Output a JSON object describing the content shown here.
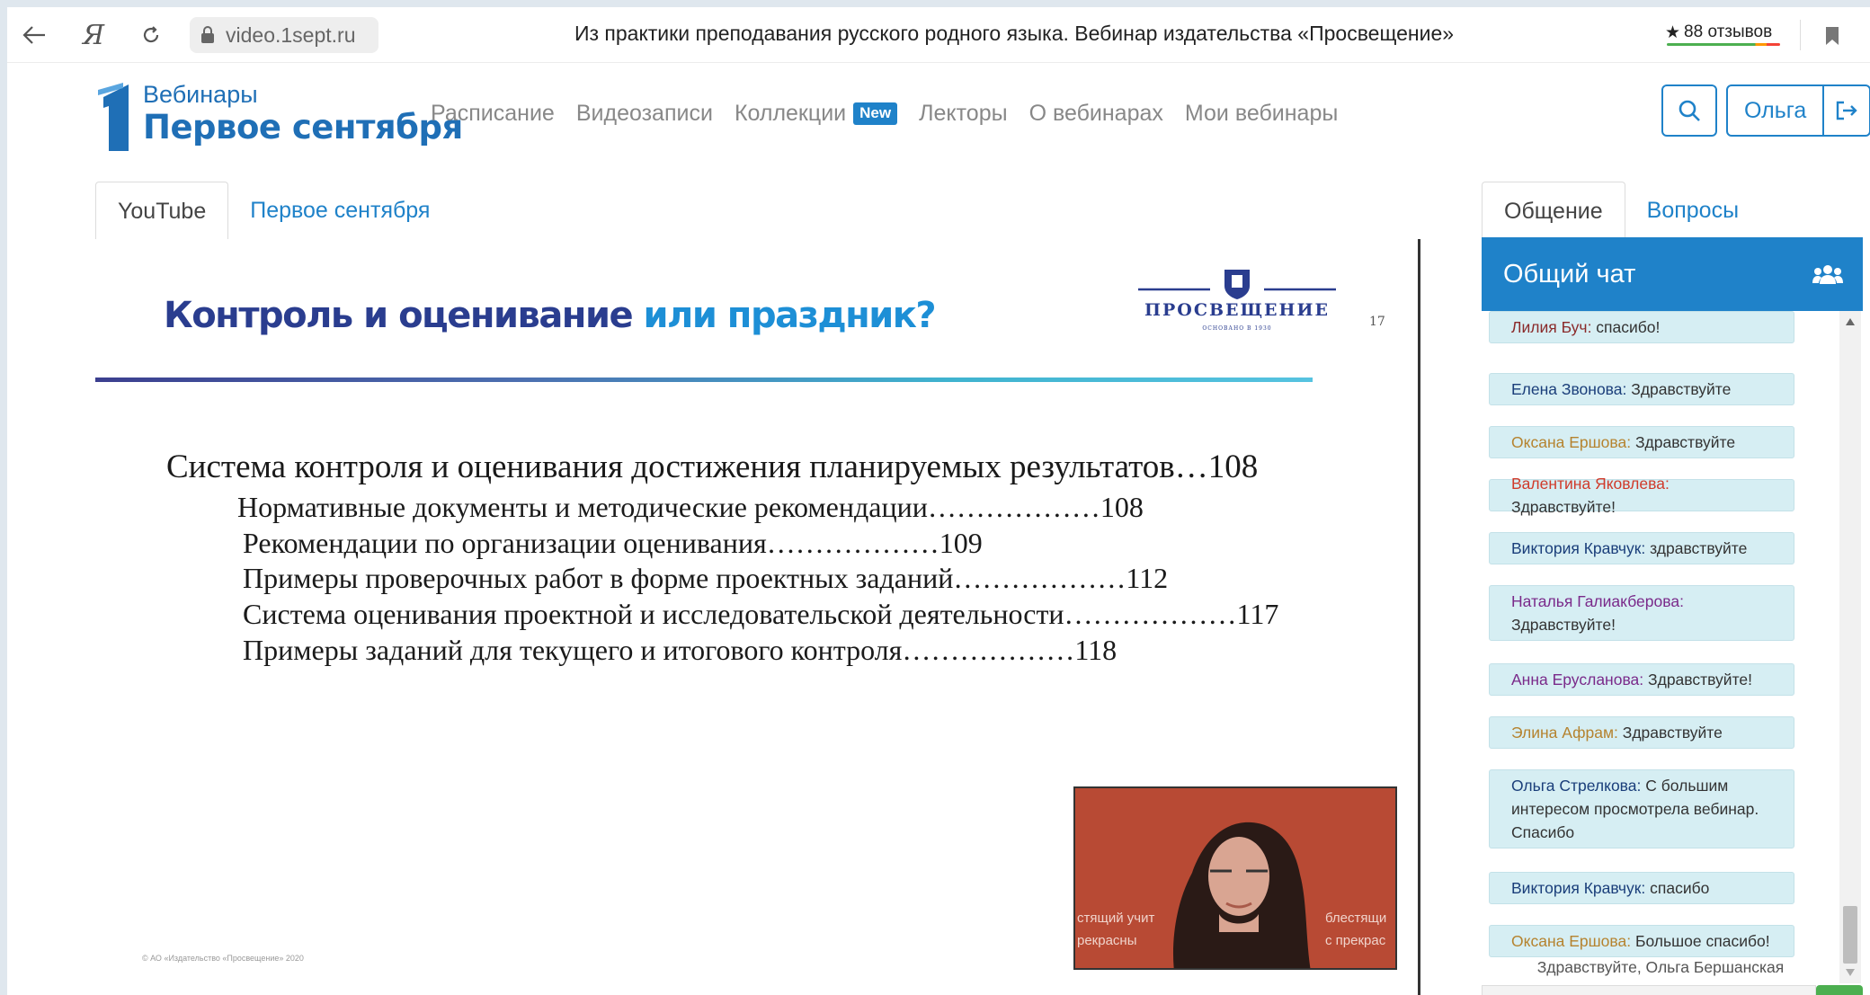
{
  "browser": {
    "url": "video.1sept.ru",
    "tab_title": "Из практики преподавания русского родного языка. Вебинар издательства «Просвещение»",
    "reviews": "88 отзывов",
    "ya_label": "Я"
  },
  "site": {
    "logo_small": "Вебинары",
    "logo_big": "Первое сентября",
    "nav": [
      "Расписание",
      "Видеозаписи",
      "Коллекции",
      "Лекторы",
      "О вебинарах",
      "Мои вебинары"
    ],
    "new_badge": "New",
    "user_name": "Ольга"
  },
  "video_tabs": [
    "YouTube",
    "Первое сентября"
  ],
  "slide": {
    "title_part1": "Контроль и оценивание ",
    "title_part2": "или праздник?",
    "publisher": "ПРОСВЕЩЕНИЕ",
    "publisher_sub": "ОСНОВАНО В 1930",
    "page_number": "17",
    "toc": [
      "Система контроля и оценивания достижения планируемых результатов…108",
      "Нормативные документы и методические рекомендации………………108",
      "Рекомендации по организации оценивания………………109",
      "Примеры проверочных работ в форме проектных заданий………………112",
      "Система оценивания проектной и исследовательской деятельности………………117",
      "Примеры заданий для текущего и итогового контроля………………118"
    ],
    "copyright": "© АО «Издательство «Просвещение» 2020",
    "speaker_overlay_left": "стящий учит\nрекрасны",
    "speaker_overlay_right": "блестящи\nс прекрас"
  },
  "chat": {
    "tabs": [
      "Общение",
      "Вопросы"
    ],
    "title": "Общий чат",
    "messages": [
      {
        "author": "Лилия Буч",
        "text": "спасибо!",
        "color": "#8a2a2a"
      },
      {
        "author": "Елена Звонова",
        "text": "Здравствуйте",
        "color": "#1a3e7a"
      },
      {
        "author": "Оксана Ершова",
        "text": "Здравствуйте",
        "color": "#b5832f"
      },
      {
        "author": "Валентина Яковлева",
        "text": "Здравствуйте!",
        "color": "#d03a2a"
      },
      {
        "author": "Виктория Кравчук",
        "text": "здравствуйте",
        "color": "#1a3e7a"
      },
      {
        "author": "Наталья Галиакберова",
        "text": "Здравствуйте!",
        "color": "#7a2a8a"
      },
      {
        "author": "Анна Ерусланова",
        "text": "Здравствуйте!",
        "color": "#7a2a8a"
      },
      {
        "author": "Элина Афрам",
        "text": "Здравствуйте",
        "color": "#b5832f"
      },
      {
        "author": "Ольга Стрелкова",
        "text": "С большим интересом просмотрела вебинар. Спасибо",
        "color": "#1a3e7a"
      },
      {
        "author": "Виктория Кравчук",
        "text": "спасибо",
        "color": "#1a3e7a"
      },
      {
        "author": "Оксана Ершова",
        "text": "Большое спасибо!",
        "color": "#b5832f"
      }
    ],
    "greeting": "Здравствуйте, Ольга Бершанская"
  }
}
